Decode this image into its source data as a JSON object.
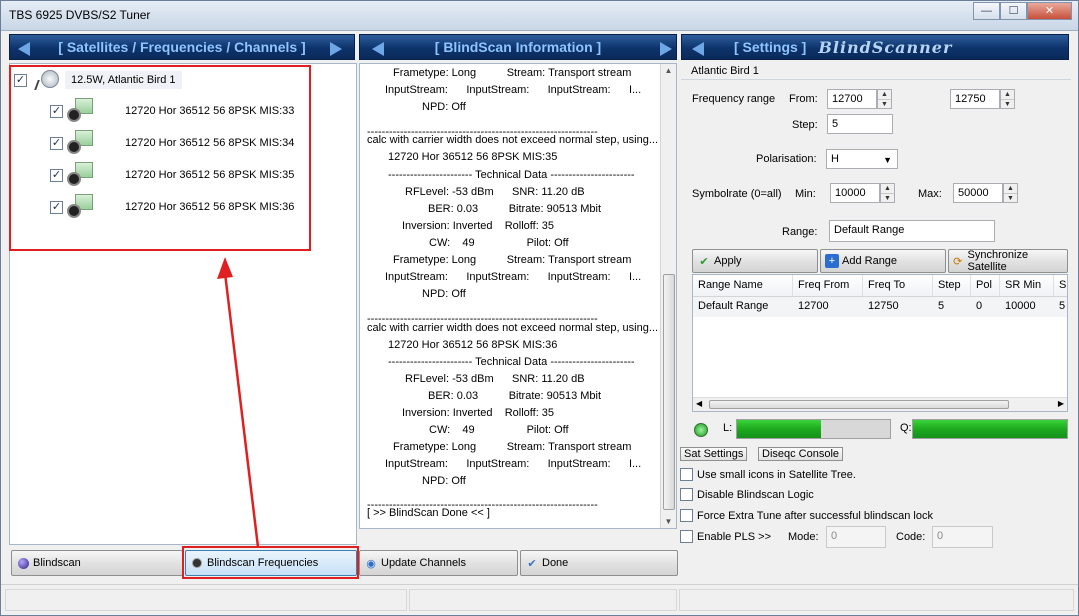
{
  "window": {
    "title": "TBS 6925 DVBS/S2 Tuner",
    "minimize": "—",
    "maximize": "☐",
    "close": "✕"
  },
  "headers": {
    "sat_freq": "[ Satellites / Frequencies / Channels ]",
    "blindscan_info": "[ BlindScan Information ]",
    "settings": "[ Settings ]",
    "logo": "BlindScanner"
  },
  "tree": {
    "satellite": "12.5W,  Atlantic Bird 1",
    "transponders": [
      "12720 Hor 36512 56 8PSK MIS:33",
      "12720 Hor 36512 56 8PSK MIS:34",
      "12720 Hor 36512 56 8PSK MIS:35",
      "12720 Hor 36512 56 8PSK MIS:36"
    ]
  },
  "info_lines": [
    "Frametype: Long          Stream: Transport stream",
    "InputStream:      InputStream:      InputStream:      I...",
    "NPD: Off",
    "---------------------------------------------------------------",
    "calc with carrier width does not exceed normal step, using...",
    "12720 Hor 36512 56 8PSK MIS:35",
    "----------------------- Technical Data -----------------------",
    "RFLevel: -53 dBm      SNR: 11.20 dB",
    "BER: 0.03          Bitrate: 90513 Mbit",
    "Inversion: Inverted    Rolloff: 35",
    "CW:    49                 Pilot: Off",
    "Frametype: Long          Stream: Transport stream",
    "InputStream:      InputStream:      InputStream:      I...",
    "NPD: Off",
    "---------------------------------------------------------------",
    "calc with carrier width does not exceed normal step, using...",
    "12720 Hor 36512 56 8PSK MIS:36",
    "----------------------- Technical Data -----------------------",
    "RFLevel: -53 dBm      SNR: 11.20 dB",
    "BER: 0.03          Bitrate: 90513 Mbit",
    "Inversion: Inverted    Rolloff: 35",
    "CW:    49                 Pilot: Off",
    "Frametype: Long          Stream: Transport stream",
    "InputStream:      InputStream:      InputStream:      I...",
    "NPD: Off",
    "---------------------------------------------------------------",
    "[ >> BlindScan Done << ]"
  ],
  "settings": {
    "satellite_name": "Atlantic Bird 1",
    "frequency_range_label": "Frequency range",
    "from_label": "From:",
    "from_value": "12700",
    "to_value": "12750",
    "step_label": "Step:",
    "step_value": "5",
    "polarisation_label": "Polarisation:",
    "polarisation_value": "H",
    "symbolrate_label": "Symbolrate (0=all)",
    "min_label": "Min:",
    "min_value": "10000",
    "max_label": "Max:",
    "max_value": "50000",
    "range_label": "Range:",
    "range_value": "Default Range",
    "apply_label": "Apply",
    "add_range_label": "Add Range",
    "sync_label": "Synchronize Satellite",
    "grid_columns": [
      "Range Name",
      "Freq From",
      "Freq To",
      "Step",
      "Pol",
      "SR Min",
      "S"
    ],
    "grid_row": [
      "Default Range",
      "12700",
      "12750",
      "5",
      "0",
      "10000",
      "5"
    ],
    "l_label": "L:",
    "q_label": "Q:",
    "l_level": 0.55,
    "q_level": 1.0,
    "sat_settings_tab": "Sat Settings",
    "diseqc_console_tab": "Diseqc Console",
    "opt_small_icons": "Use small icons in Satellite Tree.",
    "opt_disable_logic": "Disable Blindscan Logic",
    "opt_force_tune": "Force Extra Tune after successful blindscan lock",
    "opt_enable_pls": "Enable PLS >>",
    "mode_label": "Mode:",
    "mode_value": "0",
    "code_label": "Code:",
    "code_value": "0"
  },
  "buttons": {
    "blindscan": "Blindscan",
    "blindscan_frequencies": "Blindscan Frequencies",
    "update_channels": "Update Channels",
    "done": "Done"
  },
  "colors": {
    "header_bg": "#0d336b",
    "header_text": "#8fc4ff",
    "annotation": "#e02020",
    "signal_green": "#1ea91e"
  }
}
